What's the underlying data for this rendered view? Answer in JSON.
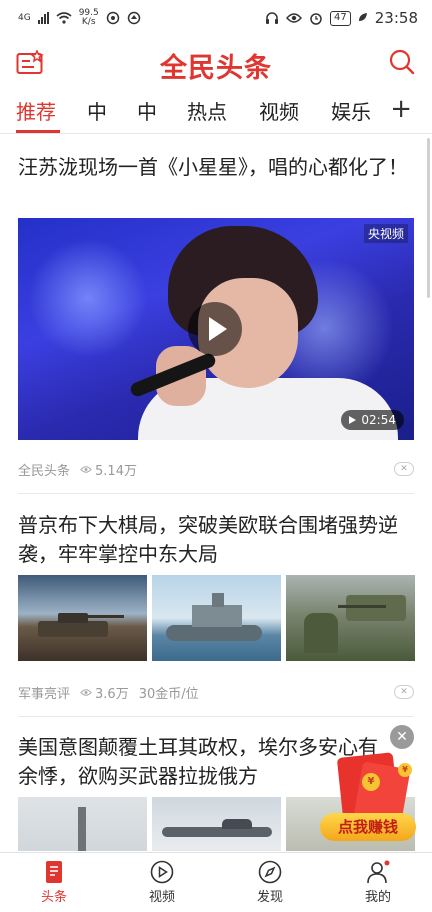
{
  "status_bar": {
    "signal_label": "4G",
    "net_speed_value": "99.5",
    "net_speed_unit": "K/s",
    "battery": "47",
    "time": "23:58"
  },
  "app": {
    "logo_text": "全民头条",
    "accent_color": "#e0362f"
  },
  "tabs": [
    {
      "label": "推荐",
      "active": true
    },
    {
      "label": "中"
    },
    {
      "label": "中"
    },
    {
      "label": "热点"
    },
    {
      "label": "视频"
    },
    {
      "label": "娱乐"
    }
  ],
  "tab_add_label": "+",
  "feed": [
    {
      "title": "汪苏泷现场一首《小星星》，唱的心都化了！",
      "source": "全民头条",
      "views": "5.14万",
      "video_duration": "02:54",
      "video_watermark": "央视频"
    },
    {
      "title": "普京布下大棋局，突破美欧联合围堵强势逆袭，牢牢掌控中东大局",
      "source": "军事亮评",
      "views": "3.6万",
      "reward": "30金币/位"
    },
    {
      "title": "美国意图颠覆土耳其政权，埃尔多安心有余悸，欲购买武器拉拢俄方"
    }
  ],
  "red_packet": {
    "button_label": "点我赚钱",
    "coin_symbol": "¥"
  },
  "bottom_nav": [
    {
      "label": "头条",
      "icon": "headline-icon",
      "active": true
    },
    {
      "label": "视频",
      "icon": "play-circle-icon"
    },
    {
      "label": "发现",
      "icon": "compass-icon"
    },
    {
      "label": "我的",
      "icon": "user-icon"
    }
  ]
}
